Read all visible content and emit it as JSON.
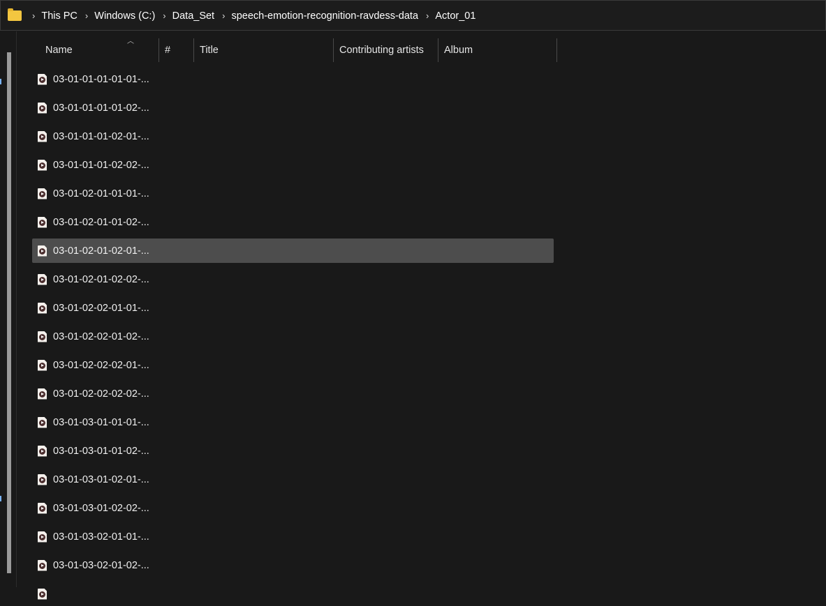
{
  "breadcrumb": [
    "This PC",
    "Windows (C:)",
    "Data_Set",
    "speech-emotion-recognition-ravdess-data",
    "Actor_01"
  ],
  "columns": {
    "name": "Name",
    "number": "#",
    "title": "Title",
    "artists": "Contributing artists",
    "album": "Album"
  },
  "files": [
    "03-01-01-01-01-01-...",
    "03-01-01-01-01-02-...",
    "03-01-01-01-02-01-...",
    "03-01-01-01-02-02-...",
    "03-01-02-01-01-01-...",
    "03-01-02-01-01-02-...",
    "03-01-02-01-02-01-...",
    "03-01-02-01-02-02-...",
    "03-01-02-02-01-01-...",
    "03-01-02-02-01-02-...",
    "03-01-02-02-02-01-...",
    "03-01-02-02-02-02-...",
    "03-01-03-01-01-01-...",
    "03-01-03-01-01-02-...",
    "03-01-03-01-02-01-...",
    "03-01-03-01-02-02-...",
    "03-01-03-02-01-01-...",
    "03-01-03-02-01-02-...",
    ""
  ],
  "selected_index": 6
}
